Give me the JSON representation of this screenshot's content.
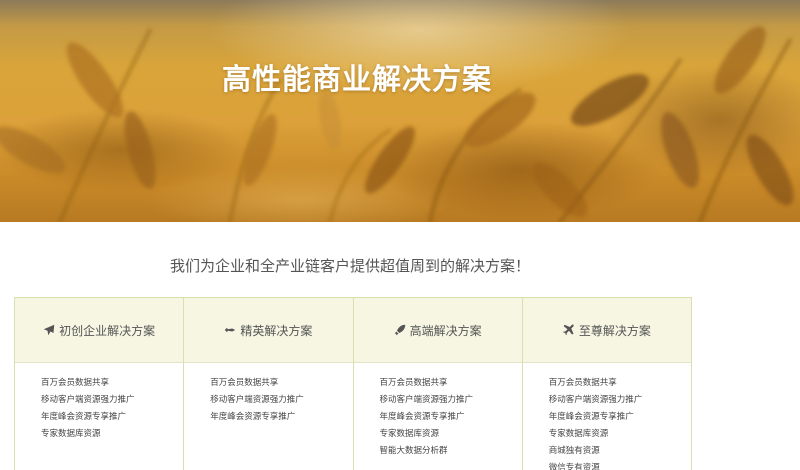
{
  "hero": {
    "title": "高性能商业解决方案"
  },
  "subtitle": "我们为企业和全产业链客户提供超值周到的解决方案！",
  "plans": [
    {
      "title": "初创企业解决方案",
      "icon": "paper-plane-icon",
      "items": [
        "百万会员数据共享",
        "移动客户端资源强力推广",
        "年度峰会资源专享推广",
        "专家数据库资源"
      ]
    },
    {
      "title": "精英解决方案",
      "icon": "fighter-jet-icon",
      "items": [
        "百万会员数据共享",
        "移动客户端资源强力推广",
        "年度峰会资源专享推广"
      ]
    },
    {
      "title": "高端解决方案",
      "icon": "rocket-icon",
      "items": [
        "百万会员数据共享",
        "移动客户端资源强力推广",
        "年度峰会资源专享推广",
        "专家数据库资源",
        "智能大数据分析群"
      ]
    },
    {
      "title": "至尊解决方案",
      "icon": "airplane-icon",
      "items": [
        "百万会员数据共享",
        "移动客户端资源强力推广",
        "年度峰会资源专享推广",
        "专家数据库资源",
        "商城独有资源",
        "微信专有资源"
      ]
    }
  ],
  "colors": {
    "panel_border": "#d9dfae",
    "panel_header_bg": "#f6f6e3",
    "text": "#555555"
  }
}
